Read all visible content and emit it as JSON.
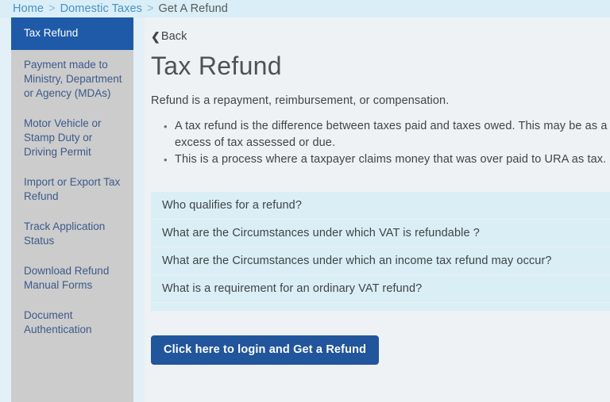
{
  "breadcrumb": {
    "items": [
      {
        "label": "Home",
        "current": false
      },
      {
        "label": "Domestic Taxes",
        "current": false
      },
      {
        "label": "Get A Refund",
        "current": true
      }
    ],
    "separator": ">"
  },
  "sidebar": {
    "items": [
      {
        "label": "Tax Refund",
        "active": true
      },
      {
        "label": "Payment made to Ministry, Department or Agency (MDAs)",
        "active": false
      },
      {
        "label": "Motor Vehicle or Stamp Duty or Driving Permit",
        "active": false
      },
      {
        "label": "Import or Export Tax Refund",
        "active": false
      },
      {
        "label": "Track Application Status",
        "active": false
      },
      {
        "label": "Download Refund Manual Forms",
        "active": false
      },
      {
        "label": "Document Authentication",
        "active": false
      }
    ]
  },
  "main": {
    "back_label": "Back",
    "back_icon": "chevron-left-icon",
    "title": "Tax Refund",
    "lead": "Refund is a repayment, reimbursement, or compensation.",
    "bullets": [
      "A tax refund is the difference between taxes paid and taxes owed. This may be as a result of an error or in excess of tax assessed or due.",
      "This is a process where a taxpayer claims money that was over paid to URA as tax."
    ],
    "accordion": [
      {
        "question": "Who qualifies for a refund?"
      },
      {
        "question": "What are the Circumstances under which VAT is refundable ?"
      },
      {
        "question": "What are the Circumstances under which an income tax refund may occur?"
      },
      {
        "question": "What is a requirement for an ordinary VAT refund?"
      }
    ],
    "cta_label": "Click here to login and Get a Refund"
  },
  "colors": {
    "breadcrumb_bar": "#d9eef7",
    "breadcrumb_link": "#4a90c2",
    "sidebar_bg": "#cccccc",
    "sidebar_active_bg": "#1e5aa8",
    "sidebar_text": "#3d5a8a",
    "main_bg": "#eef2f4",
    "accordion_bg": "#daeef5",
    "cta_bg": "#21559c",
    "page_bg": "#e3f0f7"
  }
}
